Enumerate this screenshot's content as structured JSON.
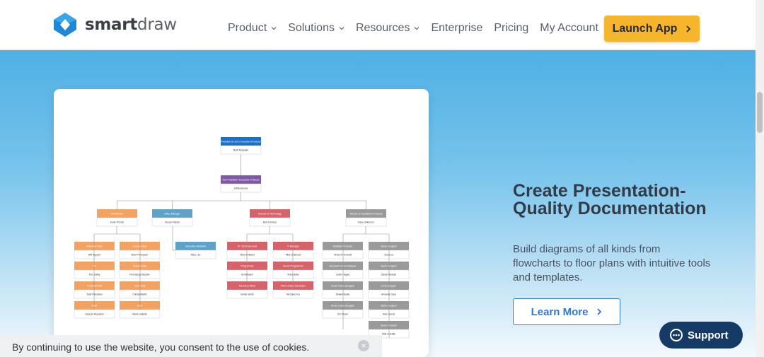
{
  "header": {
    "logo_text_bold": "smart",
    "logo_text_light": "draw",
    "nav": [
      "Product",
      "Solutions",
      "Resources",
      "Enterprise",
      "Pricing",
      "My Account"
    ],
    "launch_label": "Launch App"
  },
  "hero": {
    "title": "Create Presentation-Quality Documentation",
    "description": "Build diagrams of all kinds from flowcharts to floor plans with intuitive tools and templates.",
    "learn_more_label": "Learn More"
  },
  "cookie": {
    "text": "By continuing to use the website, you consent to the use of cookies."
  },
  "support": {
    "label": "Support"
  },
  "org_chart": {
    "ceo": {
      "title": "President & CEO / Executive Producer",
      "name": "Brett McQuaid"
    },
    "vp": {
      "title": "Vice President / Executive Producer",
      "name": "Jeffrey Bosse"
    },
    "heads": [
      {
        "title": "Art Director",
        "name": "Kevin Pircote"
      },
      {
        "title": "Office Manager",
        "name": "Susan Parlato"
      },
      {
        "title": "Director of Technology",
        "name": "Bob Johnson"
      },
      {
        "title": "Director of Operations Producer",
        "name": "Dave Gilkerson"
      }
    ],
    "art_team": [
      {
        "title": "Animation Mod",
        "name": "Will Nguyen"
      },
      {
        "title": "Art",
        "name": "Tom Gatby"
      },
      {
        "title": "Production Art",
        "name": "Todd Parkinson"
      },
      {
        "title": "Artist",
        "name": "Hannah Reynolds"
      },
      {
        "title": "Concept Mod",
        "name": "Brad Thompson"
      },
      {
        "title": "Texture Artist",
        "name": "Five Bergschneider"
      },
      {
        "title": "Lead Artist",
        "name": "Christy Martin"
      },
      {
        "title": "Artist",
        "name": "Marie LaBella"
      }
    ],
    "office_team": [
      {
        "title": "Executive Assistant",
        "name": "Mary Lee"
      }
    ],
    "tech_team": [
      {
        "title": "Sr. Technical Lead",
        "name": "Mary Kirkland"
      },
      {
        "title": "Programmer",
        "name": "Scott Baum"
      },
      {
        "title": "Technical Writer",
        "name": "Emilie Smith"
      },
      {
        "title": "IT Manager",
        "name": "Mike Shierlock"
      },
      {
        "title": "Senior Programmer",
        "name": "Anna Batle"
      },
      {
        "title": "Web Content Developer",
        "name": "Nicholas Fox"
      }
    ],
    "ops_team": [
      {
        "title": "Assistant Producer",
        "name": "Vincent Forwards"
      },
      {
        "title": "Associate Game Designer",
        "name": "Justin Hagan"
      },
      {
        "title": "Senior Game Designer",
        "name": "Shawn Burke"
      },
      {
        "title": "Senior Game Designer",
        "name": "Jim Glover"
      },
      {
        "title": "Game Producer",
        "name": "Matt Condille"
      },
      {
        "title": "Game Designer",
        "name": "Zion Lua"
      },
      {
        "title": "Game Designer",
        "name": "Daniel Birdsell"
      },
      {
        "title": "Level Designer",
        "name": "Amanda Clare"
      },
      {
        "title": "Game Designer",
        "name": "Alex Downs"
      }
    ]
  },
  "colors": {
    "ceo": "#1f6fc4",
    "vp": "#7e5aa6",
    "art": "#f4a261",
    "office": "#5ea2c9",
    "tech": "#d6626a",
    "ops": "#9a9a9a",
    "accent": "#f7b52c",
    "link": "#2f7ad1"
  }
}
